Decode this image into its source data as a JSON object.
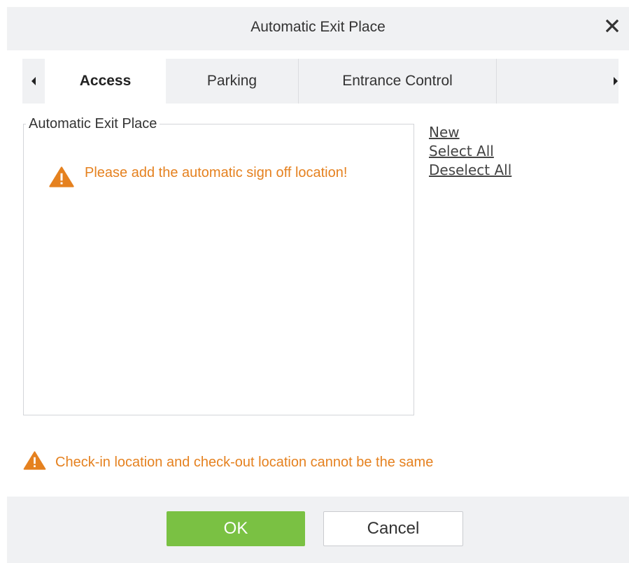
{
  "dialog": {
    "title": "Automatic Exit Place",
    "close_icon": "close-icon"
  },
  "tabs": {
    "left_arrow_icon": "caret-left-icon",
    "right_arrow_icon": "caret-right-icon",
    "items": [
      {
        "label": "Access",
        "active": true
      },
      {
        "label": "Parking",
        "active": false
      },
      {
        "label": "Entrance Control",
        "active": false
      }
    ]
  },
  "panel": {
    "legend": "Automatic Exit Place",
    "empty_message": "Please add the automatic sign off location!",
    "warning_icon": "warning-icon"
  },
  "actions": {
    "new_label": "New",
    "select_all_label": "Select All",
    "deselect_all_label": "Deselect All"
  },
  "note": {
    "text": "Check-in location and check-out location cannot be the same",
    "warning_icon": "warning-icon"
  },
  "footer": {
    "ok_label": "OK",
    "cancel_label": "Cancel"
  },
  "colors": {
    "warning": "#e5811f",
    "ok_button": "#7ac143",
    "header_bg": "#f0f1f3"
  }
}
